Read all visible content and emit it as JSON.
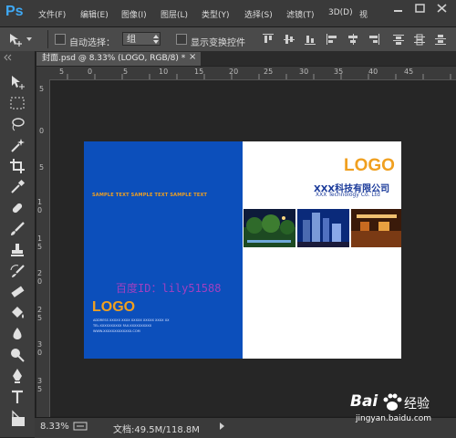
{
  "menubar": {
    "app_logo": "Ps",
    "items": [
      "文件(F)",
      "编辑(E)",
      "图像(I)",
      "图层(L)",
      "类型(Y)",
      "选择(S)",
      "滤镜(T)",
      "3D(D)",
      "视"
    ]
  },
  "options": {
    "auto_select_label": "自动选择：",
    "group_value": "组",
    "show_transform_label": "显示变换控件"
  },
  "document": {
    "tab_title": "封面.psd @ 8.33% (LOGO, RGB/8) *",
    "tab_close": "×",
    "ruler_top": [
      "5",
      "0",
      "5",
      "10",
      "15",
      "20",
      "25",
      "30",
      "35",
      "40",
      "45"
    ],
    "ruler_left": [
      "5",
      "0",
      "5",
      "1 0",
      "1 5",
      "2 0",
      "2 5",
      "3 0",
      "3 5"
    ]
  },
  "artwork": {
    "back_logo": "LOGO",
    "sample_text": "SAMPLE TEXT SAMPLE TEXT SAMPLE TEXT",
    "baidu_id": "百度ID：lily51588",
    "front_logo": "LOGO",
    "company_cn": "XXX科技有限公司",
    "company_en": "XXX Technology Co. Ltd",
    "address_lines": [
      "ADDRESS XXXXX XXXX XXXXX XXXXX XXXX XX",
      "TEL:XXXXXXXXXX FAX:XXXXXXXXXX",
      "WWW.XXXXXXXXXXXXX.COM"
    ]
  },
  "status": {
    "zoom": "8.33%",
    "doc_info": "文档:49.5M/118.8M"
  },
  "watermark": {
    "brand": "Bai",
    "brand_tail": "经验",
    "url": "jingyan.baidu.com"
  },
  "colors": {
    "blue_panel": "#0c4fbb",
    "logo_orange": "#f0a020",
    "company_blue": "#1a3a9a",
    "ps_blue": "#3fa9f5"
  }
}
